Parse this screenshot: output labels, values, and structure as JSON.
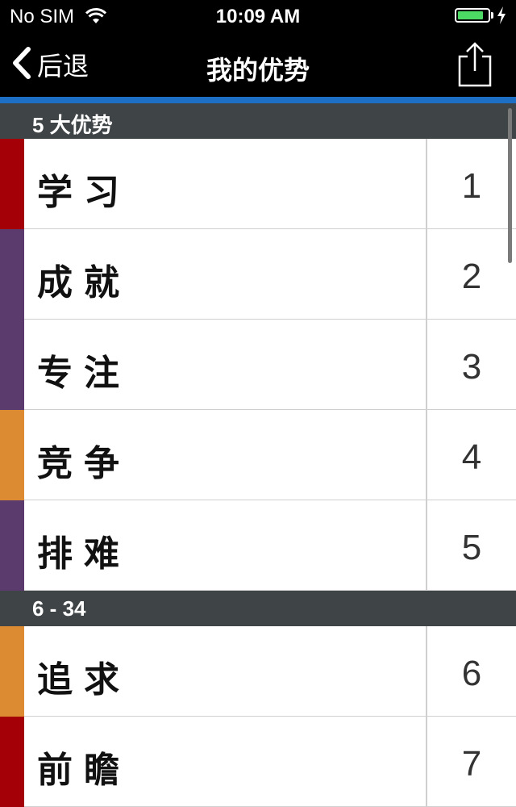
{
  "status_bar": {
    "carrier": "No SIM",
    "time": "10:09 AM",
    "battery_level": 0.85
  },
  "nav": {
    "back_label": "后退",
    "title": "我的优势"
  },
  "colors": {
    "nav_accent": "#1c6fc4",
    "section_header_bg": "#3f4446",
    "red": "#a30008",
    "purple": "#5b3a6e",
    "orange": "#dc8b32"
  },
  "sections": [
    {
      "header": "5 大优势",
      "rows": [
        {
          "name": "学习",
          "rank": "1",
          "color": "#a30008"
        },
        {
          "name": "成就",
          "rank": "2",
          "color": "#5b3a6e"
        },
        {
          "name": "专注",
          "rank": "3",
          "color": "#5b3a6e"
        },
        {
          "name": "竞争",
          "rank": "4",
          "color": "#dc8b32"
        },
        {
          "name": "排难",
          "rank": "5",
          "color": "#5b3a6e"
        }
      ]
    },
    {
      "header": "6 - 34",
      "rows": [
        {
          "name": "追求",
          "rank": "6",
          "color": "#dc8b32"
        },
        {
          "name": "前瞻",
          "rank": "7",
          "color": "#a30008"
        }
      ]
    }
  ]
}
